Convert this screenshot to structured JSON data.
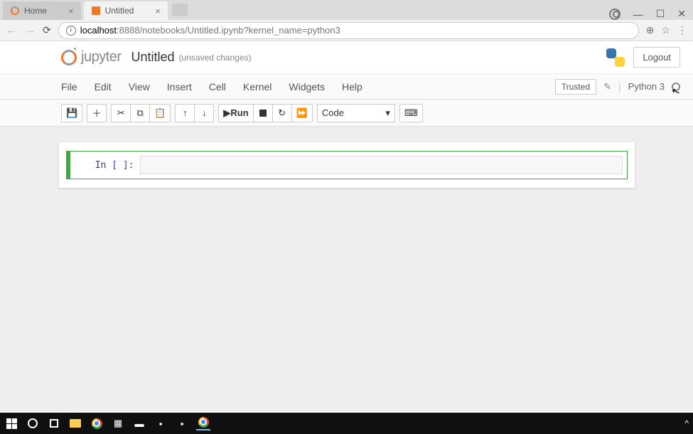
{
  "browser": {
    "tabs": [
      {
        "title": "Home"
      },
      {
        "title": "Untitled"
      }
    ],
    "url_host": "localhost",
    "url_port_path": ":8888/notebooks/Untitled.ipynb?kernel_name=python3"
  },
  "header": {
    "logo_text": "jupyter",
    "notebook_title": "Untitled",
    "save_status": "(unsaved changes)",
    "logout_label": "Logout"
  },
  "menubar": {
    "items": [
      "File",
      "Edit",
      "View",
      "Insert",
      "Cell",
      "Kernel",
      "Widgets",
      "Help"
    ],
    "trusted_label": "Trusted",
    "kernel_label": "Python 3"
  },
  "toolbar": {
    "run_label": "Run",
    "celltype_value": "Code"
  },
  "cell": {
    "prompt": "In [ ]:"
  }
}
